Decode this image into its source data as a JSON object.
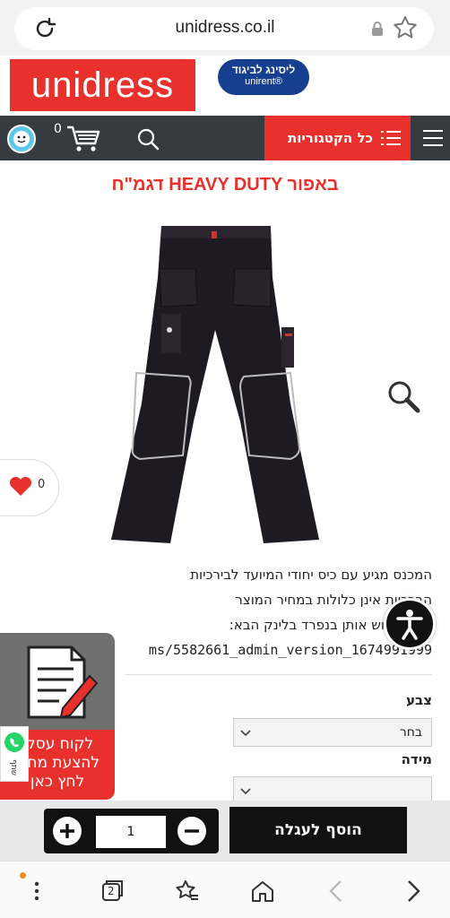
{
  "browser": {
    "url": "unidress.co.il",
    "tabs_count": "2"
  },
  "header": {
    "logo_text": "unidress",
    "unirent_line1": "ליסינג לביגוד",
    "unirent_line2": "unirent®",
    "categories_label": "כל הקטגוריות",
    "cart_count": "0",
    "brand_color": "#e8312d",
    "nav_color": "#363b42"
  },
  "product": {
    "title": "דגמ\"ח HEAVY DUTY באפור",
    "favorites_count": "0",
    "description_lines": [
      "המכנס מגיע עם כיס יחודי המיועד לבירכיות",
      "הברכיות אינן כלולות במחיר המוצר",
      "ניתן לרכוש אותן בנפרד בלינק הבא:",
      "ms/5582661_admin_version_1674991999"
    ],
    "color_label": "צבע",
    "color_value": "בחר",
    "size_label": "מידה",
    "size_value": ""
  },
  "quote_widget": {
    "line1": "לקוח עסקי",
    "line2": "להצעת מחיר",
    "line3": "לחץ כאן",
    "share_label": "שתף"
  },
  "cart": {
    "quantity": "1",
    "add_label": "הוסף לעגלה"
  }
}
